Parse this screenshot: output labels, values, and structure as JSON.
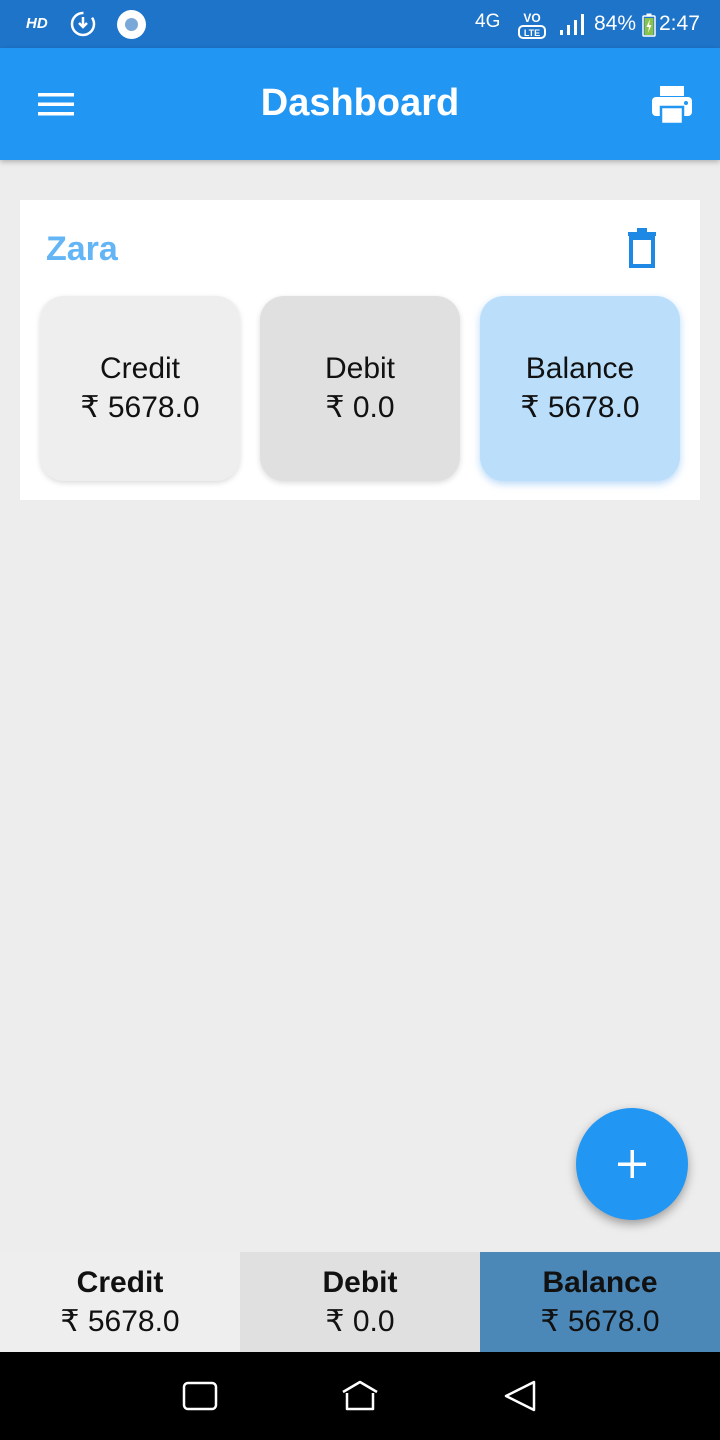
{
  "status_bar": {
    "hd": "HD",
    "network": "4G",
    "battery_pct": "84%",
    "time": "2:47",
    "icons": [
      "sync-icon",
      "record-icon",
      "volte-icon",
      "signal-icon",
      "battery-charging-icon"
    ]
  },
  "app_bar": {
    "title": "Dashboard",
    "menu_icon": "menu-icon",
    "print_icon": "print-icon"
  },
  "account": {
    "name": "Zara",
    "delete_icon": "delete-icon",
    "credit_label": "Credit",
    "credit_value": "₹ 5678.0",
    "debit_label": "Debit",
    "debit_value": "₹ 0.0",
    "balance_label": "Balance",
    "balance_value": "₹ 5678.0"
  },
  "fab": {
    "icon": "plus-icon"
  },
  "totals": {
    "credit_label": "Credit",
    "credit_value": "₹ 5678.0",
    "debit_label": "Debit",
    "debit_value": "₹ 0.0",
    "balance_label": "Balance",
    "balance_value": "₹ 5678.0"
  },
  "nav_bar": {
    "icons": [
      "recents-icon",
      "home-icon",
      "back-icon"
    ]
  },
  "colors": {
    "status_bar": "#1e74c9",
    "app_bar": "#2196f3",
    "account_name": "#64b5f6",
    "balance_tile": "#bbdefb",
    "balance_total": "#4b88b8",
    "background": "#ededed"
  }
}
